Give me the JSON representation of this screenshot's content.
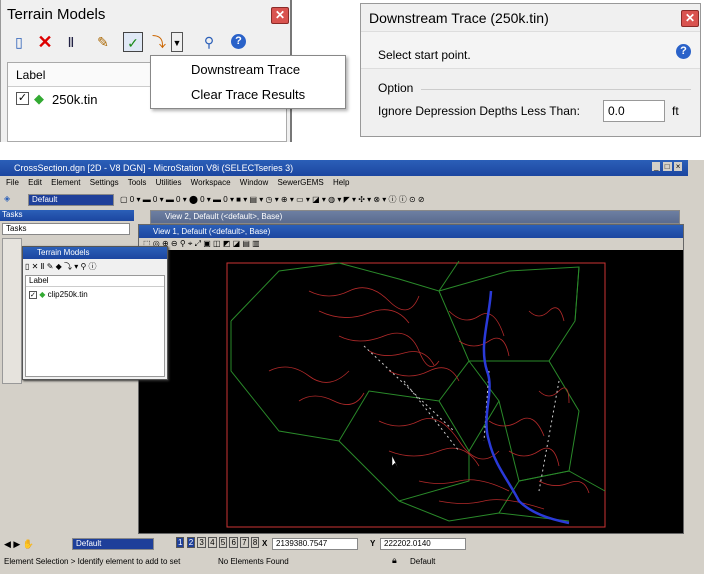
{
  "terrain_dialog": {
    "title": "Terrain Models",
    "column_label": "Label",
    "item": "250k.tin"
  },
  "context_menu": {
    "items": [
      "Downstream Trace",
      "Clear Trace Results"
    ]
  },
  "trace_dialog": {
    "title": "Downstream Trace (250k.tin)",
    "prompt": "Select start point.",
    "section": "Option",
    "field_label": "Ignore Depression Depths Less Than:",
    "value": "0.0",
    "unit": "ft"
  },
  "microstation": {
    "title": "CrossSection.dgn [2D - V8 DGN] - MicroStation V8i (SELECTseries 3)",
    "menu": [
      "File",
      "Edit",
      "Element",
      "Settings",
      "Tools",
      "Utilities",
      "Workspace",
      "Window",
      "SewerGEMS",
      "Help"
    ],
    "level": "Default",
    "tasks_title": "Tasks",
    "tasks_dropdown": "Tasks",
    "view2_title": "View 2, Default (<default>, Base)",
    "view1_title": "View 1, Default (<default>, Base)",
    "mini_terrain_title": "Terrain Models",
    "mini_label": "Label",
    "mini_item": "clip250k.tin",
    "view_buttons": [
      "1",
      "2",
      "3",
      "4",
      "5",
      "6",
      "7",
      "8"
    ],
    "x_label": "X",
    "x_value": "2139380.7547",
    "y_label": "Y",
    "y_value": "222202.0140",
    "status_left": "Element Selection > Identify element to add to set",
    "status_mid": "No Elements Found",
    "status_right": "Default",
    "bottom_level": "Default"
  }
}
